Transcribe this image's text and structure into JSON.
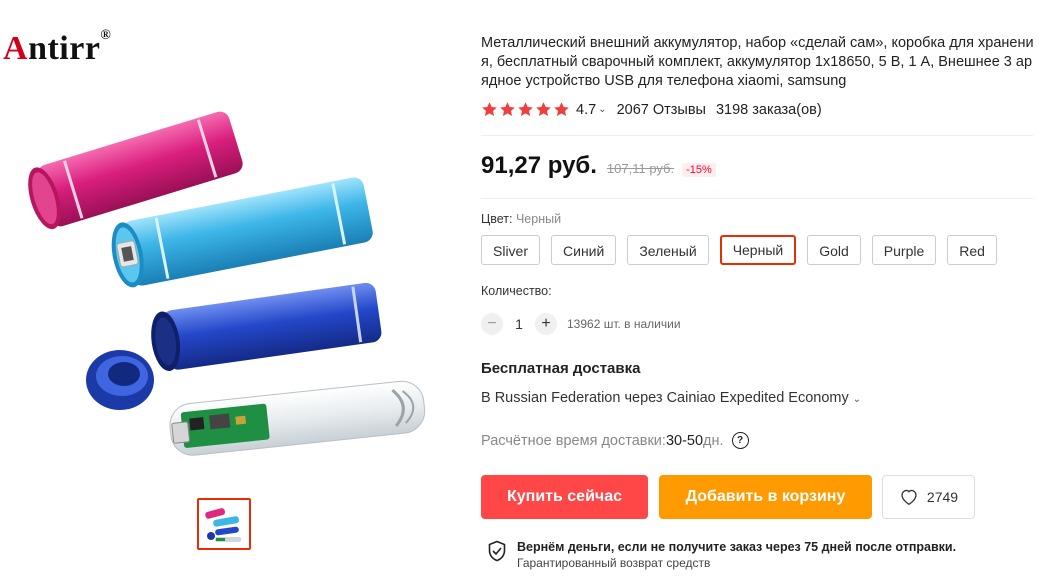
{
  "brand": {
    "first_letter": "A",
    "rest": "ntirr",
    "mark": "®"
  },
  "product": {
    "title": "Металлический внешний аккумулятор, набор «сделай сам», коробка для хранения, бесплатный сварочный комплект, аккумулятор 1x18650, 5 В, 1 А, Внешнее 3 арядное устройство USB для телефона xiaomi, samsung",
    "rating_value": "4.7",
    "rating_stars": 5,
    "reviews": "2067 Отзывы",
    "orders": "3198 заказа(ов)"
  },
  "price": {
    "current": "91,27 руб.",
    "old": "107,11 руб.",
    "discount": "-15%"
  },
  "color": {
    "label": "Цвет: ",
    "selected": "Черный",
    "options": [
      "Sliver",
      "Синий",
      "Зеленый",
      "Черный",
      "Gold",
      "Purple",
      "Red"
    ]
  },
  "quantity": {
    "label": "Количество:",
    "minus": "−",
    "value": "1",
    "plus": "+",
    "stock": "13962 шт. в наличии"
  },
  "shipping": {
    "title": "Бесплатная доставка",
    "method": "В Russian Federation через Cainiao Expedited Economy",
    "eta_label": "Расчётное время доставки: ",
    "eta_value": "30-50",
    "eta_unit": "дн.",
    "help": "?"
  },
  "actions": {
    "buy": "Купить сейчас",
    "cart": "Добавить в корзину",
    "wishlist_count": "2749"
  },
  "guarantee": {
    "line1": "Вернём деньги, если не получите заказ через 75 дней после отправки.",
    "line2": "Гарантированный возврат средств"
  },
  "colors": {
    "accent": "#ff4747",
    "cart": "#ff9a00",
    "selected_border": "#e62e04",
    "star": "#f03e3e"
  },
  "icons": {
    "rating": "star-icon",
    "wishlist": "heart-icon",
    "guarantee": "shield-check-icon",
    "chevron": "chevron-down-icon",
    "help": "help-circle-icon"
  }
}
